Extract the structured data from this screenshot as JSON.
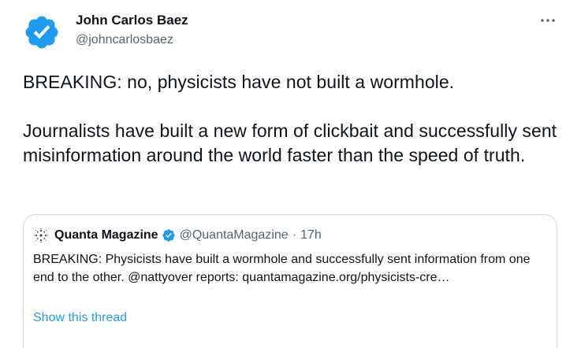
{
  "tweet": {
    "author_name": "John Carlos Baez",
    "author_handle": "@johncarlosbaez",
    "verified": true,
    "more_icon": "ellipsis-icon",
    "text_lines": [
      "BREAKING: no, physicists have not built a wormhole.",
      "Journalists have built a new form of clickbait and successfully sent misinformation around the world faster than the speed of truth."
    ]
  },
  "quoted": {
    "name": "Quanta Magazine",
    "handle": "@QuantaMagazine",
    "separator": "·",
    "time": "17h",
    "text": "BREAKING: Physicists have built a wormhole and successfully sent information from one end to the other. @nattyover reports: quantamagazine.org/physicists-cre…",
    "show_thread": "Show this thread",
    "verified": true
  },
  "colors": {
    "text": "#0f1419",
    "secondary": "#536471",
    "accent": "#1d9bf0",
    "border": "#cfd9de"
  }
}
